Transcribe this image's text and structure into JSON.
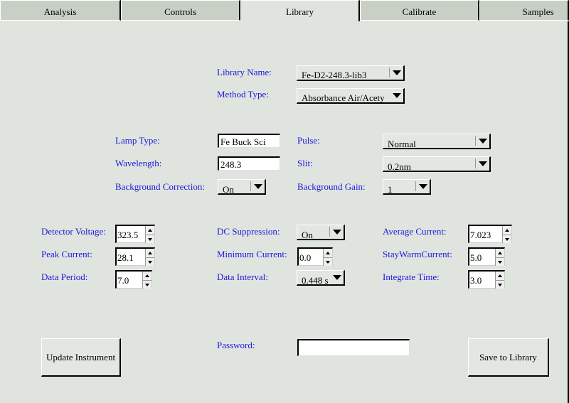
{
  "tabs": [
    {
      "label": "Analysis",
      "active": false
    },
    {
      "label": "Controls",
      "active": false
    },
    {
      "label": "Library",
      "active": true
    },
    {
      "label": "Calibrate",
      "active": false
    },
    {
      "label": "Samples",
      "active": false
    }
  ],
  "library": {
    "name_label": "Library Name:",
    "name_value": "Fe-D2-248.3-lib3",
    "method_label": "Method Type:",
    "method_value": "Absorbance Air/Acety"
  },
  "lamp": {
    "lamp_type_label": "Lamp Type:",
    "lamp_type_value": "Fe Buck Sci",
    "wavelength_label": "Wavelength:",
    "wavelength_value": "248.3",
    "bg_correction_label": "Background Correction:",
    "bg_correction_value": "On",
    "pulse_label": "Pulse:",
    "pulse_value": "Normal",
    "slit_label": "Slit:",
    "slit_value": "0.2nm",
    "bg_gain_label": "Background Gain:",
    "bg_gain_value": "1"
  },
  "detector": {
    "detector_voltage_label": "Detector Voltage:",
    "detector_voltage_value": "323.5",
    "peak_current_label": "Peak Current:",
    "peak_current_value": "28.1",
    "data_period_label": "Data Period:",
    "data_period_value": "7.0",
    "dc_suppression_label": "DC Suppression:",
    "dc_suppression_value": "On",
    "minimum_current_label": "Minimum Current:",
    "minimum_current_value": "0.0",
    "data_interval_label": "Data Interval:",
    "data_interval_value": "0.448 s",
    "average_current_label": "Average Current:",
    "average_current_value": "7.023",
    "staywarm_current_label": "StayWarmCurrent:",
    "staywarm_current_value": "5.0",
    "integrate_time_label": "Integrate Time:",
    "integrate_time_value": "3.0"
  },
  "footer": {
    "update_button": "Update Instrument",
    "password_label": "Password:",
    "password_value": "",
    "save_button": "Save to Library"
  }
}
